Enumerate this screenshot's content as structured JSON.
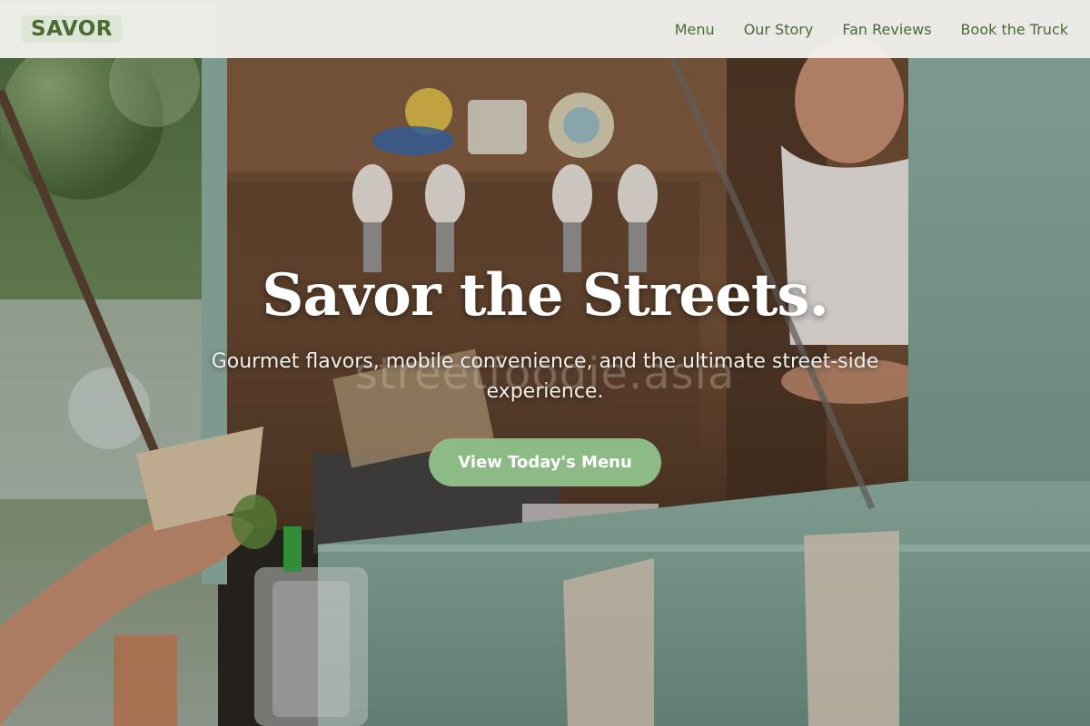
{
  "nav": {
    "logo": "SAVOR",
    "links": [
      "Menu",
      "Our Story",
      "Fan Reviews",
      "Book the Truck"
    ]
  },
  "hero": {
    "title": "Savor the Streets.",
    "subtitle": "Gourmet flavors, mobile convenience, and the ultimate street-side experience.",
    "cta_label": "View Today's Menu",
    "watermark": "streetfoodie.asia",
    "image_description_icon": "food-truck-photo"
  },
  "colors": {
    "brand_green": "#4a6b34",
    "logo_bg": "#dde5d6",
    "cta_bg": "#8dbb85",
    "nav_bg": "#f3f1ed",
    "truck_teal": "#8fb0a3"
  }
}
